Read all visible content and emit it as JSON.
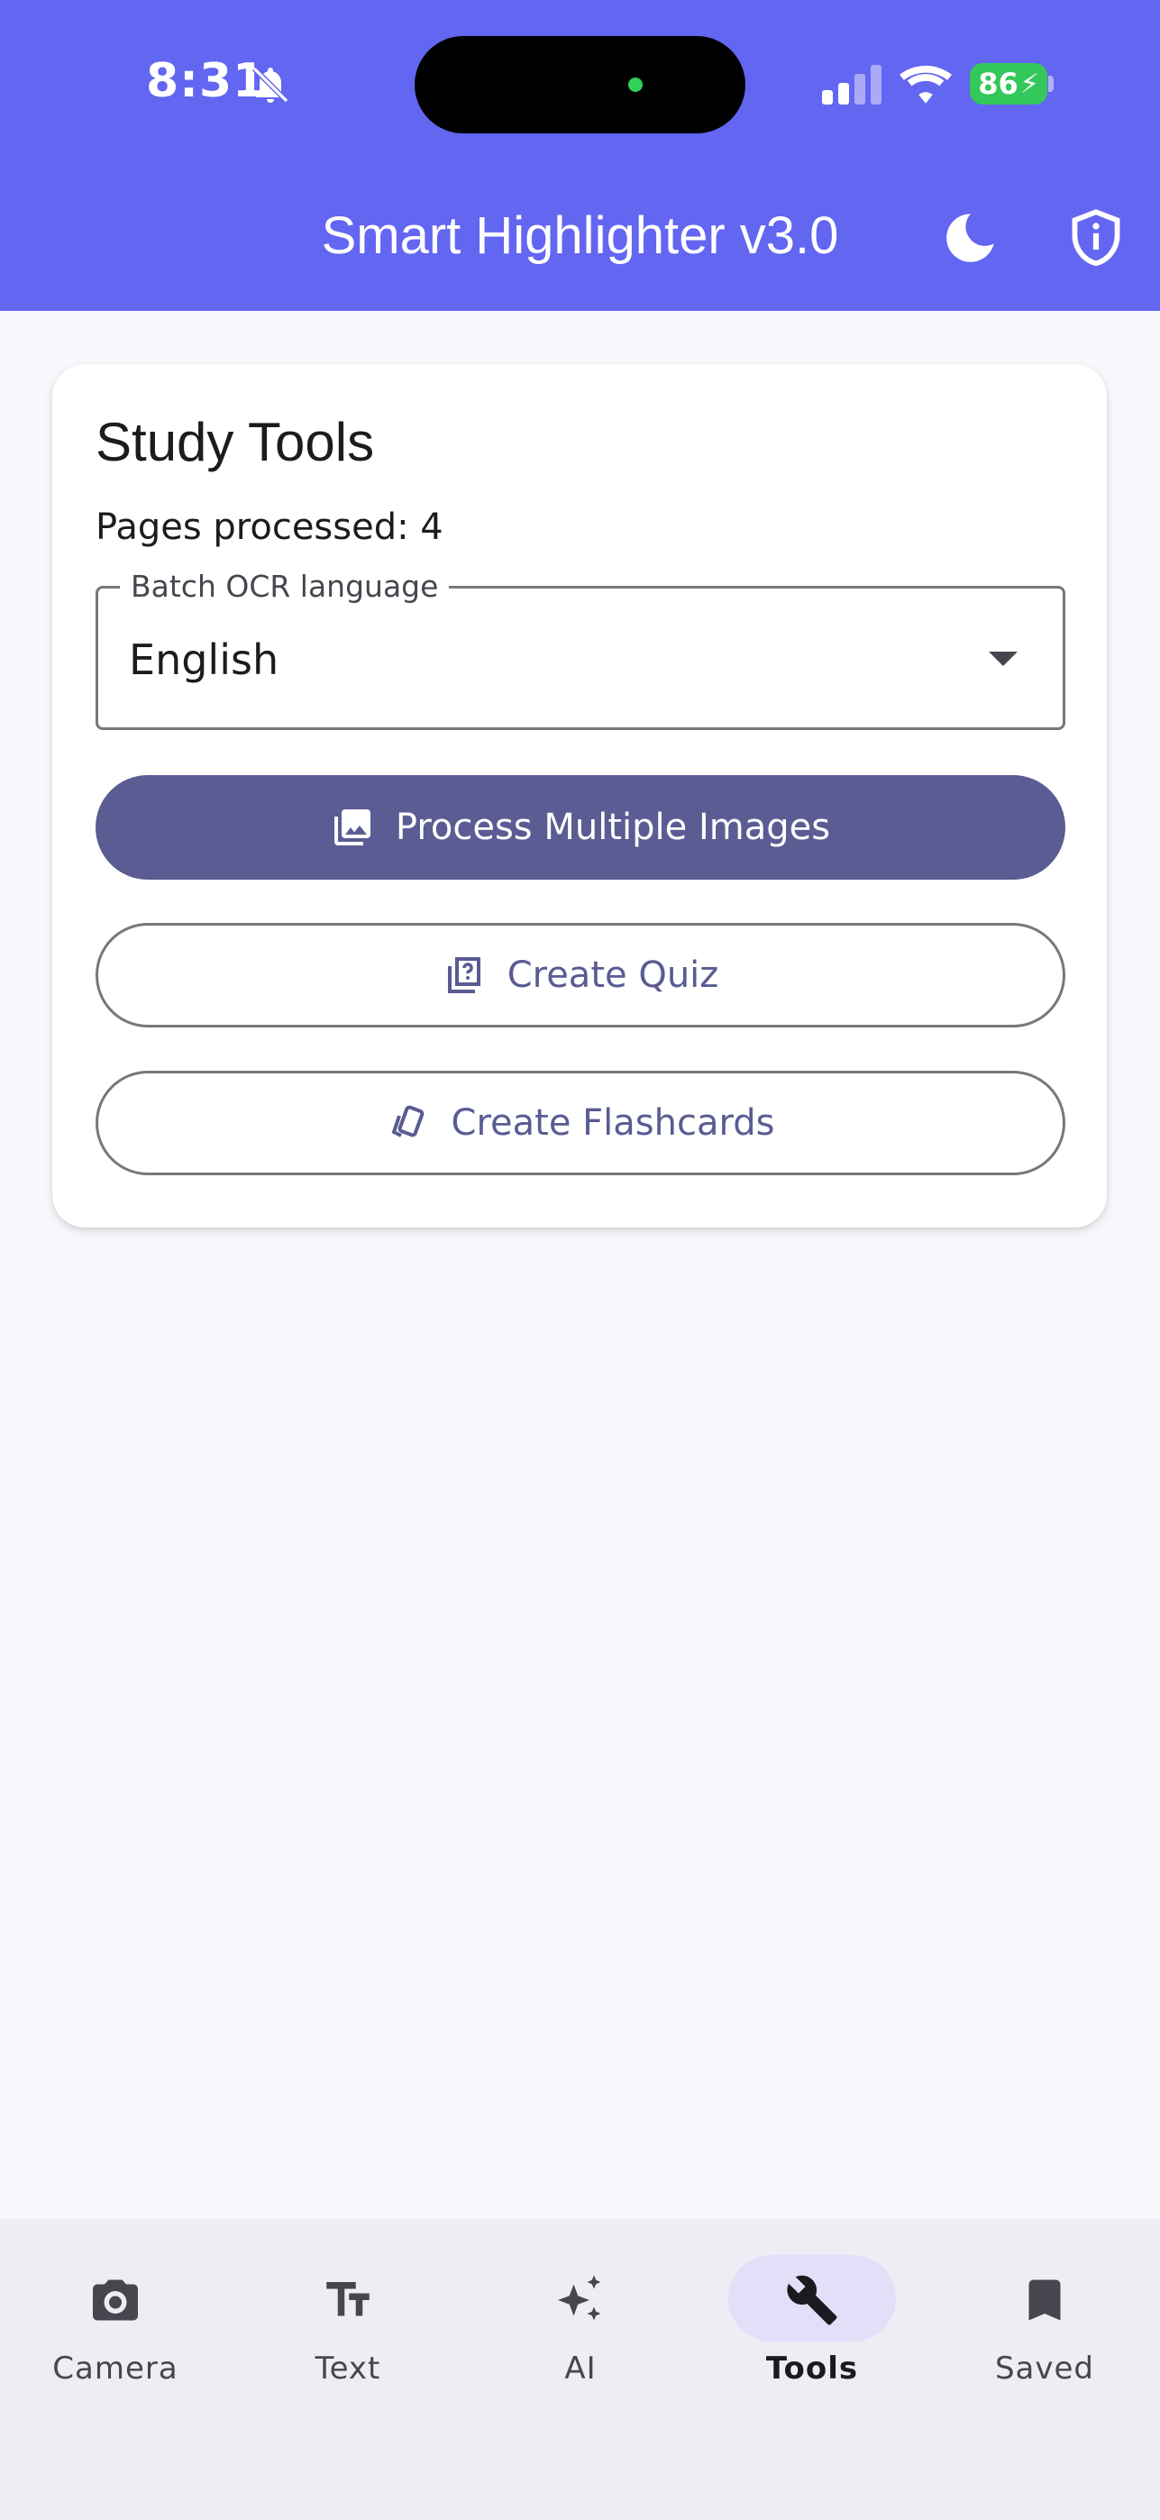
{
  "status_bar": {
    "time": "8:31",
    "battery": "86",
    "icons": [
      "bell-muted-icon",
      "signal-icon",
      "wifi-icon",
      "battery-charging-icon"
    ]
  },
  "app_bar": {
    "title": "Smart Highlighter v3.0",
    "actions": [
      "moon-icon",
      "shield-info-icon"
    ]
  },
  "card": {
    "title": "Study Tools",
    "pages_processed": "Pages processed: 4",
    "ocr_select": {
      "label": "Batch OCR language",
      "value": "English"
    },
    "buttons": {
      "process": "Process Multiple Images",
      "quiz": "Create Quiz",
      "flashcards": "Create Flashcards"
    }
  },
  "bottom_nav": {
    "items": [
      {
        "label": "Camera",
        "icon": "camera-icon"
      },
      {
        "label": "Text",
        "icon": "text-fields-icon"
      },
      {
        "label": "AI",
        "icon": "sparkle-icon"
      },
      {
        "label": "Tools",
        "icon": "wrench-icon",
        "active": true
      },
      {
        "label": "Saved",
        "icon": "bookmark-icon"
      }
    ]
  },
  "colors": {
    "app_bar": "#6366F1",
    "primary_button": "#5A5C93",
    "outlined_text": "#595B92",
    "nav_bg": "#EFECF3",
    "nav_active_pill": "#E2E0F9"
  }
}
